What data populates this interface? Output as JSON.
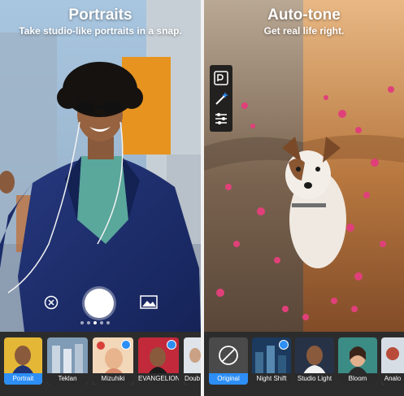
{
  "left": {
    "title": "Portraits",
    "subtitle": "Take studio-like portraits in a snap.",
    "carousel_dots": 5,
    "active_dot": 2,
    "thumbnails": [
      {
        "label": "Portrait",
        "selected": true
      },
      {
        "label": "Teklan",
        "selected": false
      },
      {
        "label": "Mizuhiki",
        "selected": false
      },
      {
        "label": "EVANGELION..",
        "selected": false
      },
      {
        "label": "Doub",
        "selected": false
      }
    ]
  },
  "right": {
    "title": "Auto-tone",
    "subtitle": "Get real life right.",
    "tools": [
      {
        "icon": "psx-icon"
      },
      {
        "icon": "magic-wand-icon"
      },
      {
        "icon": "sliders-icon"
      }
    ],
    "thumbnails": [
      {
        "label": "Original",
        "selected": true
      },
      {
        "label": "Night Shift",
        "selected": false
      },
      {
        "label": "Studio Light",
        "selected": false
      },
      {
        "label": "Bloom",
        "selected": false
      },
      {
        "label": "Analo",
        "selected": false
      }
    ]
  },
  "colors": {
    "accent": "#2d8ef5",
    "strip": "#2c2c2c",
    "jacket": "#1f3272",
    "shirt": "#5aa79b",
    "bloom_pink": "#e0407a"
  }
}
